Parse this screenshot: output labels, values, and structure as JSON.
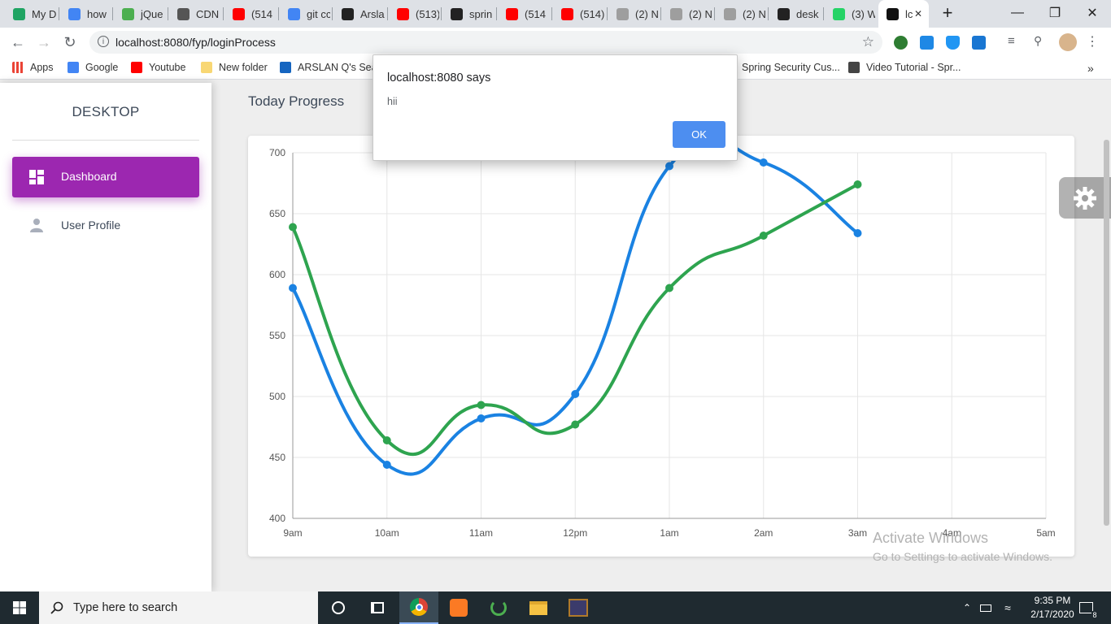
{
  "browser": {
    "tabs": [
      {
        "label": "My D",
        "icon": "google-drive-icon",
        "color": "#1fa463"
      },
      {
        "label": "how",
        "icon": "google-icon",
        "color": "#4285f4"
      },
      {
        "label": "jQue",
        "icon": "w3schools-icon",
        "color": "#4caf50"
      },
      {
        "label": "CDN",
        "icon": "chat-icon",
        "color": "#555555"
      },
      {
        "label": "(514",
        "icon": "youtube-icon",
        "color": "#ff0000"
      },
      {
        "label": "git cc",
        "icon": "google-icon",
        "color": "#4285f4"
      },
      {
        "label": "Arsla",
        "icon": "github-icon",
        "color": "#222222"
      },
      {
        "label": "(513)",
        "icon": "youtube-icon",
        "color": "#ff0000"
      },
      {
        "label": "sprin",
        "icon": "github-icon",
        "color": "#222222"
      },
      {
        "label": "(514",
        "icon": "youtube-icon",
        "color": "#ff0000"
      },
      {
        "label": "(514)",
        "icon": "youtube-icon",
        "color": "#ff0000"
      },
      {
        "label": "(2) N",
        "icon": "loading-icon",
        "color": "#9e9e9e"
      },
      {
        "label": "(2) N",
        "icon": "loading-icon",
        "color": "#9e9e9e"
      },
      {
        "label": "(2) N",
        "icon": "loading-icon",
        "color": "#9e9e9e"
      },
      {
        "label": "desk",
        "icon": "github-icon",
        "color": "#222222"
      },
      {
        "label": "(3) W",
        "icon": "whatsapp-icon",
        "color": "#25d366"
      },
      {
        "label": "lc",
        "icon": "bootstrap-icon",
        "color": "#111111",
        "active": true
      }
    ],
    "url": "localhost:8080/fyp/loginProcess",
    "bookmarks": [
      {
        "label": "Apps",
        "icon": "apps-grid-icon"
      },
      {
        "label": "Google",
        "icon": "google-icon"
      },
      {
        "label": "Youtube",
        "icon": "youtube-icon"
      },
      {
        "label": "New folder",
        "icon": "folder-icon"
      },
      {
        "label": "ARSLAN Q's Sear",
        "icon": "search-bookmark-icon"
      },
      {
        "label": "Spring Security Cus...",
        "icon": "page-icon"
      },
      {
        "label": "Video Tutorial - Spr...",
        "icon": "chat-bookmark-icon"
      }
    ]
  },
  "sidebar": {
    "brand": "DESKTOP",
    "items": [
      {
        "label": "Dashboard",
        "icon": "dashboard-icon",
        "active": true
      },
      {
        "label": "User Profile",
        "icon": "person-icon",
        "active": false
      }
    ]
  },
  "main": {
    "title": "Today Progress"
  },
  "chart_data": {
    "type": "line",
    "categories": [
      "9am",
      "10am",
      "11am",
      "12pm",
      "1am",
      "2am",
      "3am",
      "4am",
      "5am"
    ],
    "yticks": [
      400,
      450,
      500,
      550,
      600,
      650,
      700
    ],
    "ylim": [
      400,
      700
    ],
    "grid": true,
    "series": [
      {
        "color": "#1a82e2",
        "values": [
          589,
          444,
          482,
          502,
          689,
          692,
          634
        ]
      },
      {
        "color": "#2ea44f",
        "values": [
          639,
          464,
          493,
          477,
          589,
          632,
          674
        ]
      }
    ]
  },
  "dialog": {
    "title": "localhost:8080 says",
    "message": "hii",
    "ok_label": "OK"
  },
  "watermark": {
    "line1": "Activate Windows",
    "line2": "Go to Settings to activate Windows."
  },
  "taskbar": {
    "search_placeholder": "Type here to search",
    "time": "9:35 PM",
    "date": "2/17/2020",
    "notifications": "8"
  }
}
